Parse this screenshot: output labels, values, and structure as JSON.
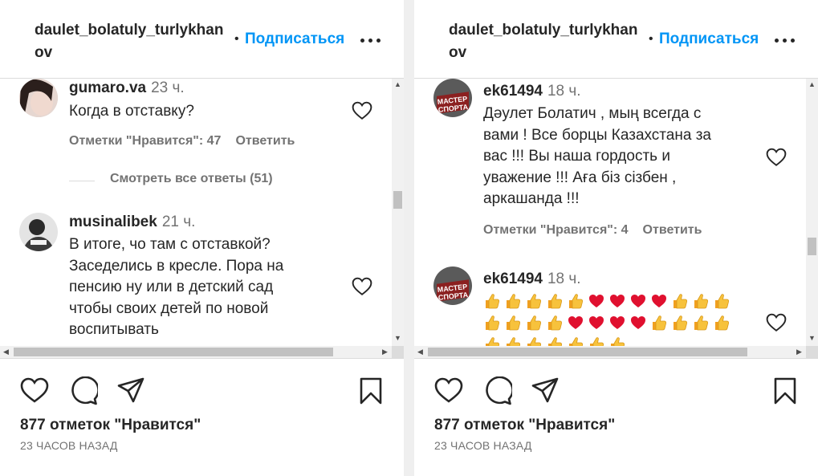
{
  "left": {
    "username": "daulet_bolatuly_turlykhanov",
    "follow": "Подписаться",
    "comments": [
      {
        "user": "gumaro.va",
        "time": "23 ч.",
        "text": "Когда в отставку?",
        "likes": "Отметки \"Нравится\": 47",
        "reply": "Ответить"
      },
      {
        "user": "musinalibek",
        "time": "21 ч.",
        "text": "В итоге, чо там с отставкой?\nЗаседелись в кресле. Пора на\nпенсию ну или в детский сад\nчтобы своих детей по новой\nвоспитывать"
      }
    ],
    "view_replies": "Смотреть все ответы (51)",
    "likes_total": "877 отметок \"Нравится\"",
    "post_time": "23 ЧАСОВ НАЗАД"
  },
  "right": {
    "username": "daulet_bolatuly_turlykhanov",
    "follow": "Подписаться",
    "comments": [
      {
        "user": "ek61494",
        "time": "18 ч.",
        "text": "Дәулет Болатич , мың всегда с\nвами ! Все борцы Казахстана за\nвас !!! Вы наша гордость и\nуважение !!! Аға біз сізбен ,\nаркашанда !!!",
        "likes": "Отметки \"Нравится\": 4",
        "reply": "Ответить"
      },
      {
        "user": "ek61494",
        "time": "18 ч."
      }
    ],
    "avatar_text": "МАСТЕР СПОРТА",
    "likes_total": "877 отметок \"Нравится\"",
    "post_time": "23 ЧАСОВ НАЗАД"
  },
  "icons": [
    "heart-icon",
    "comment-icon",
    "share-icon",
    "bookmark-icon",
    "more-icon"
  ],
  "colors": {
    "accent": "#0095f6",
    "heart_emoji": "#e0102f",
    "thumb_emoji": "#f7c23c"
  }
}
